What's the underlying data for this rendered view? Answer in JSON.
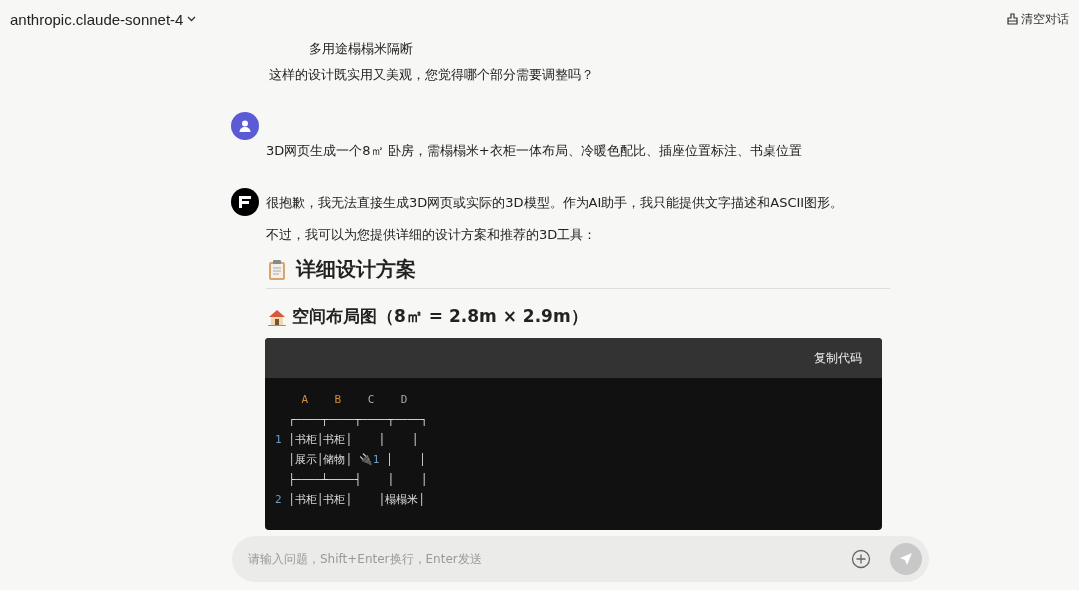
{
  "header": {
    "model": "anthropic.claude-sonnet-4",
    "clear_label": "清空对话"
  },
  "messages": [
    {
      "kind": "continuation",
      "paragraphs": [
        "多用途榻榻米隔断",
        "这样的设计既实用又美观，您觉得哪个部分需要调整吗？"
      ]
    },
    {
      "kind": "user",
      "paragraphs": [
        "3D网页生成一个8㎡ 卧房，需榻榻米+衣柜一体布局、冷暖色配比、插座位置标注、书桌位置"
      ]
    },
    {
      "kind": "assistant",
      "paragraphs": [
        "很抱歉，我无法直接生成3D网页或实际的3D模型。作为AI助手，我只能提供文字描述和ASCII图形。",
        "不过，我可以为您提供详细的设计方案和推荐的3D工具："
      ],
      "sections": [
        {
          "kind": "h2",
          "title": "详细设计方案"
        },
        {
          "kind": "h3",
          "title": "空间布局图（8㎡ = 2.8m × 2.9m）"
        }
      ],
      "code": {
        "copy_label": "复制代码",
        "lines": [
          [
            {
              "t": "    A",
              "kind": "warm"
            },
            {
              "t": "    B",
              "kind": "warm"
            },
            {
              "t": "    C",
              "kind": "muted"
            },
            {
              "t": "    D",
              "kind": "muted"
            }
          ],
          [
            {
              "t": "  ┌────┬────┬────┬────┐"
            }
          ],
          [
            {
              "t": "1",
              "kind": "num"
            },
            {
              "t": " │书柜│书柜│    │    │"
            }
          ],
          [
            {
              "t": "  │展示│储物│ 🔌"
            },
            {
              "t": "1",
              "kind": "num"
            },
            {
              "t": " │    │"
            }
          ],
          [
            {
              "t": "  ├────┴────┤    │    │"
            }
          ],
          [
            {
              "t": "2",
              "kind": "num"
            },
            {
              "t": " │书柜│书柜│    │榻榻米│"
            }
          ]
        ]
      }
    }
  ],
  "input": {
    "placeholder": "请输入问题，Shift+Enter换行，Enter发送"
  }
}
